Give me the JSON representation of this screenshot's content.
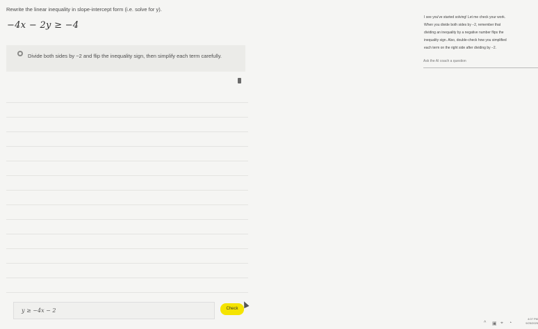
{
  "problem": {
    "prompt": "Rewrite the linear inequality in slope-intercept form (i.e. solve for y).",
    "expression": "−4x − 2y ≥ −4"
  },
  "step": {
    "icon": "step-bullet-icon",
    "text": "Divide both sides by −2 and flip the inequality sign, then simplify each term carefully."
  },
  "answer": {
    "value": "y ≥ −4x − 2"
  },
  "check_button": {
    "label": "Check"
  },
  "coach": {
    "lines": [
      "I see you've started solving! Let me check your work.",
      "When you divide both sides by −2, remember that",
      "dividing an inequality by a negative number flips the",
      "inequality sign. Also, double-check how you simplified",
      "each term on the right side after dividing by −2."
    ],
    "input_placeholder": "Ask the AI coach a question"
  },
  "taskbar": {
    "chevron": "^",
    "clock_time": "4:07 PM",
    "clock_date": "9/25/2025"
  },
  "colors": {
    "check_button": "#f5e400",
    "background": "#f5f5f3",
    "step_card": "#ebebe8"
  }
}
